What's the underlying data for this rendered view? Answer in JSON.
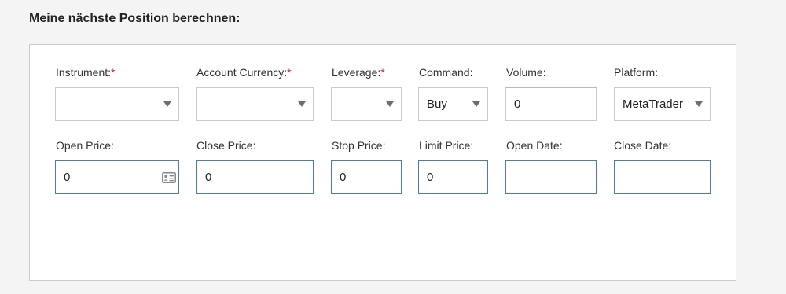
{
  "heading": "Meine nächste Position berechnen:",
  "row1": {
    "instrument": {
      "label": "Instrument:",
      "required": "*",
      "value": ""
    },
    "account_currency": {
      "label": "Account Currency:",
      "required": "*",
      "value": ""
    },
    "leverage": {
      "label": "Leverage:",
      "required": "*",
      "value": ""
    },
    "command": {
      "label": "Command:",
      "value": "Buy"
    },
    "volume": {
      "label": "Volume:",
      "value": "0"
    },
    "platform": {
      "label": "Platform:",
      "value": "MetaTrader"
    }
  },
  "row2": {
    "open_price": {
      "label": "Open Price:",
      "value": "0"
    },
    "close_price": {
      "label": "Close Price:",
      "value": "0"
    },
    "stop_price": {
      "label": "Stop Price:",
      "value": "0"
    },
    "limit_price": {
      "label": "Limit Price:",
      "value": "0"
    },
    "open_date": {
      "label": "Open Date:",
      "value": ""
    },
    "close_date": {
      "label": "Close Date:",
      "value": ""
    }
  },
  "icons": {
    "open_price_field": "contact-card-icon",
    "dropdown": "triangle-down-icon"
  },
  "colors": {
    "required": "#d9261c",
    "active_border": "#4a7db8",
    "border": "#c9cccb",
    "background": "#f3f4f3"
  }
}
